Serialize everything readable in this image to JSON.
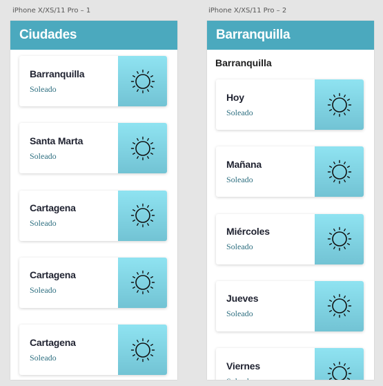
{
  "artboards": [
    {
      "label": "iPhone X/XS/11 Pro – 1"
    },
    {
      "label": "iPhone X/XS/11 Pro – 2"
    }
  ],
  "screen1": {
    "title": "Ciudades",
    "cards": [
      {
        "name": "Barranquilla",
        "status": "Soleado",
        "icon": "sun-icon"
      },
      {
        "name": "Santa Marta",
        "status": "Soleado",
        "icon": "sun-icon"
      },
      {
        "name": "Cartagena",
        "status": "Soleado",
        "icon": "sun-icon"
      },
      {
        "name": "Cartagena",
        "status": "Soleado",
        "icon": "sun-icon"
      },
      {
        "name": "Cartagena",
        "status": "Soleado",
        "icon": "sun-icon"
      }
    ]
  },
  "screen2": {
    "title": "Barranquilla",
    "subtitle": "Barranquilla",
    "cards": [
      {
        "name": "Hoy",
        "status": "Soleado",
        "icon": "sun-icon"
      },
      {
        "name": "Mañana",
        "status": "Soleado",
        "icon": "sun-icon"
      },
      {
        "name": "Miércoles",
        "status": "Soleado",
        "icon": "sun-icon"
      },
      {
        "name": "Jueves",
        "status": "Soleado",
        "icon": "sun-icon"
      },
      {
        "name": "Viernes",
        "status": "Soleado",
        "icon": "sun-icon"
      }
    ]
  },
  "colors": {
    "appbar": "#4ba9be",
    "icon_gradient_top": "#8fe3f1",
    "icon_gradient_bottom": "#72c3d4",
    "status_text": "#2e6f80"
  }
}
